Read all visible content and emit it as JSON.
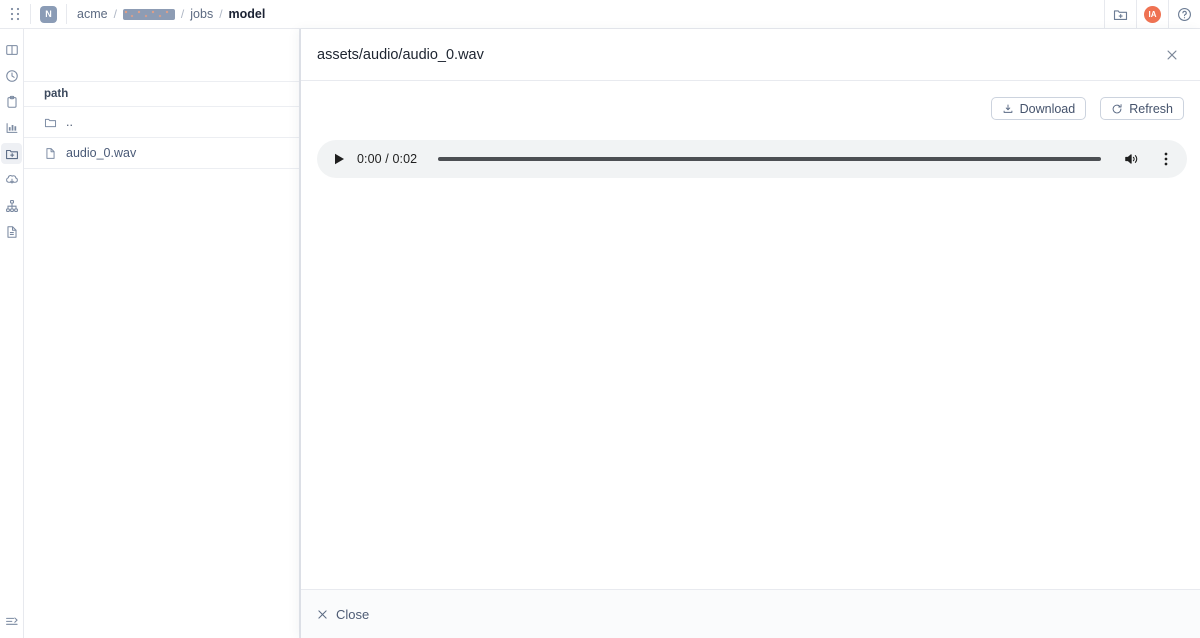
{
  "topbar": {
    "grip_icon": "drag-grip-icon",
    "logo_label": "N",
    "breadcrumbs": [
      {
        "label": "acme",
        "type": "link"
      },
      {
        "label": "",
        "type": "redacted"
      },
      {
        "label": "jobs",
        "type": "link"
      },
      {
        "label": "model",
        "type": "current"
      }
    ],
    "separator": "/",
    "actions": [
      {
        "name": "new-folder-icon",
        "label": ""
      },
      {
        "name": "user-avatar",
        "label": "IA"
      },
      {
        "name": "help-icon",
        "label": ""
      }
    ]
  },
  "rail": {
    "items": [
      {
        "icon": "panel-layout-icon",
        "active": false
      },
      {
        "icon": "clock-history-icon",
        "active": false
      },
      {
        "icon": "clipboard-icon",
        "active": false
      },
      {
        "icon": "chart-bar-icon",
        "active": false
      },
      {
        "icon": "folder-plus-icon",
        "active": true
      },
      {
        "icon": "brain-cloud-icon",
        "active": false
      },
      {
        "icon": "sitemap-network-icon",
        "active": false
      },
      {
        "icon": "document-icon",
        "active": false
      }
    ],
    "bottom": {
      "icon": "collapse-sidebar-icon"
    }
  },
  "filepanel": {
    "column_header": "path",
    "rows": [
      {
        "icon": "folder-icon",
        "label": "..",
        "kind": "folder"
      },
      {
        "icon": "file-icon",
        "label": "audio_0.wav",
        "kind": "file"
      }
    ]
  },
  "modal": {
    "title": "assets/audio/audio_0.wav",
    "close_icon": "close-icon",
    "buttons": [
      {
        "name": "download-button",
        "label": "Download",
        "icon": "download-icon"
      },
      {
        "name": "refresh-button",
        "label": "Refresh",
        "icon": "refresh-icon"
      }
    ],
    "audio": {
      "play_icon": "play-icon",
      "time_display": "0:00 / 0:02",
      "current_time": "0:00",
      "duration": "0:02",
      "progress_percent": 0,
      "volume_icon": "volume-icon",
      "more_icon": "more-vertical-icon"
    },
    "footer": {
      "close_label": "Close",
      "close_icon": "x-icon"
    }
  },
  "colors": {
    "accent": "#8b9cb6",
    "avatar": "#ef7252",
    "text": "#44546b",
    "title": "#1d2430",
    "border": "#e7e9ee",
    "player_bg": "#f1f3f4",
    "player_track": "#4c4f53"
  }
}
